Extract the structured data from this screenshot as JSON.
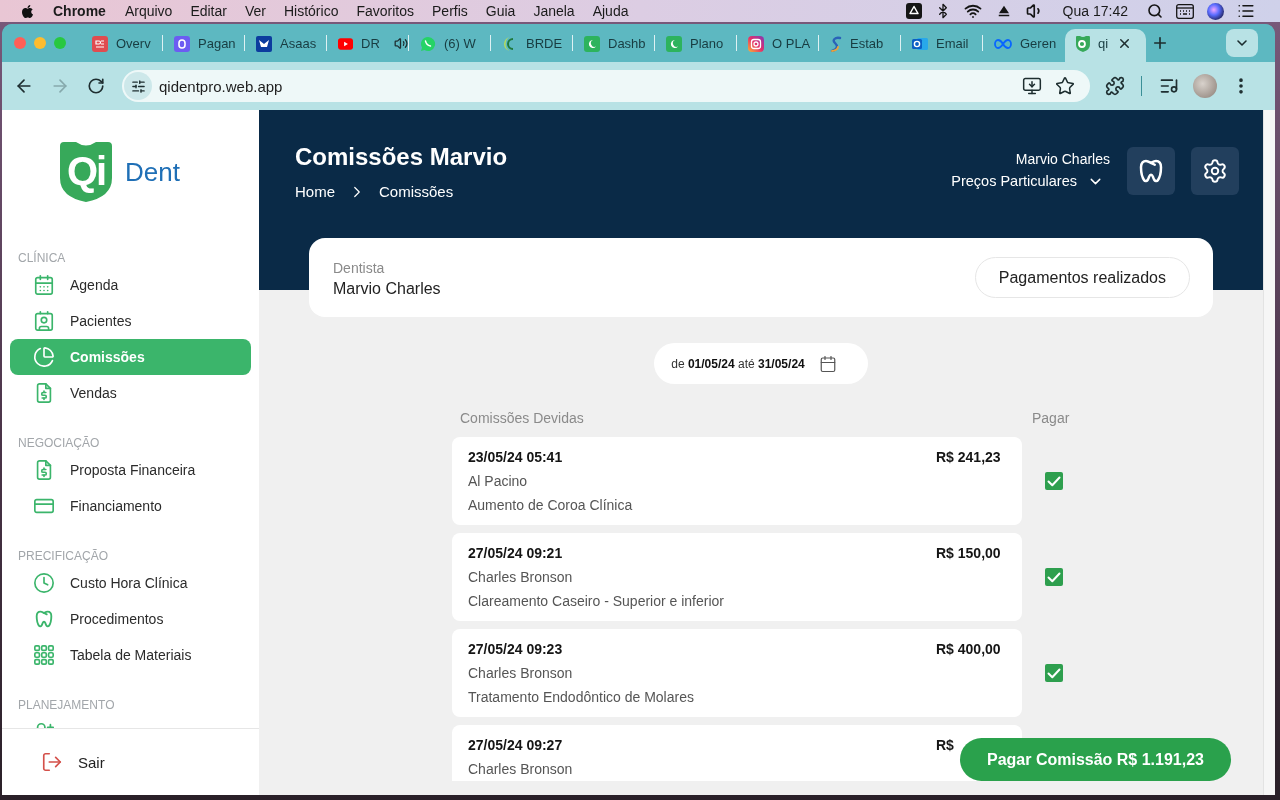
{
  "menu_bar": {
    "app": "Chrome",
    "menus": [
      "Arquivo",
      "Editar",
      "Ver",
      "Histórico",
      "Favoritos",
      "Perfis",
      "Guia",
      "Janela",
      "Ajuda"
    ],
    "clock": "Qua 17:42"
  },
  "browser": {
    "tabs": [
      {
        "title": "Overv",
        "selected": false,
        "audio": false
      },
      {
        "title": "Pagan",
        "selected": false,
        "audio": false
      },
      {
        "title": "Asaas",
        "selected": false,
        "audio": false
      },
      {
        "title": "DR",
        "selected": false,
        "audio": true
      },
      {
        "title": "(6) W",
        "selected": false,
        "audio": false
      },
      {
        "title": "BRDE",
        "selected": false,
        "audio": false
      },
      {
        "title": "Dashb",
        "selected": false,
        "audio": false
      },
      {
        "title": "Plano",
        "selected": false,
        "audio": false
      },
      {
        "title": "O PLA",
        "selected": false,
        "audio": false
      },
      {
        "title": "Estab",
        "selected": false,
        "audio": false
      },
      {
        "title": "Email",
        "selected": false,
        "audio": false
      },
      {
        "title": "Geren",
        "selected": false,
        "audio": false
      },
      {
        "title": "qi",
        "selected": true,
        "audio": false
      }
    ],
    "nav_buttons": [
      {
        "kind": "back",
        "disabled": false
      },
      {
        "kind": "forward",
        "disabled": true
      },
      {
        "kind": "reload",
        "disabled": false
      }
    ],
    "address": "qidentpro.web.app"
  },
  "sidebar": {
    "logo": {
      "mark": "Qi",
      "name": "Dent"
    },
    "sections": [
      {
        "title": "CLÍNICA",
        "items": [
          {
            "kind": "link",
            "label": "Agenda",
            "selected": false
          },
          {
            "kind": "link",
            "label": "Pacientes",
            "selected": false
          },
          {
            "kind": "link",
            "label": "Comissões",
            "selected": true
          },
          {
            "kind": "link",
            "label": "Vendas",
            "selected": false
          }
        ]
      },
      {
        "title": "NEGOCIAÇÃO",
        "items": [
          {
            "kind": "link",
            "label": "Proposta Financeira",
            "selected": false
          },
          {
            "kind": "link",
            "label": "Financiamento",
            "selected": false
          }
        ]
      },
      {
        "title": "PRECIFICAÇÃO",
        "items": [
          {
            "kind": "link",
            "label": "Custo Hora Clínica",
            "selected": false
          },
          {
            "kind": "link",
            "label": "Procedimentos",
            "selected": false
          },
          {
            "kind": "link",
            "label": "Tabela de Materiais",
            "selected": false
          }
        ]
      },
      {
        "title": "PLANEJAMENTO",
        "items": [
          {
            "kind": "icon-only",
            "selected": false
          }
        ]
      }
    ],
    "logout": "Sair"
  },
  "header": {
    "title": "Comissões Marvio",
    "breadcrumb": [
      "Home",
      "Comissões"
    ],
    "user": "Marvio Charles",
    "price_table": "Preços Particulares"
  },
  "dentist_card": {
    "label": "Dentista",
    "value": "Marvio Charles",
    "button": "Pagamentos realizados"
  },
  "date_range": "de **01/05/24** até **31/05/24**",
  "commissions": {
    "heading": "Comissões Devidas",
    "pay_heading": "Pagar",
    "rows": [
      {
        "datetime": "23/05/24 05:41",
        "amount": "R$ 241,23",
        "patient": "Al Pacino",
        "procedure": "Aumento de Coroa Clínica",
        "checked": true
      },
      {
        "datetime": "27/05/24 09:21",
        "amount": "R$ 150,00",
        "patient": "Charles Bronson",
        "procedure": "Clareamento Caseiro - Superior e inferior",
        "checked": true
      },
      {
        "datetime": "27/05/24 09:23",
        "amount": "R$ 400,00",
        "patient": "Charles Bronson",
        "procedure": "Tratamento Endodôntico de Molares",
        "checked": true
      },
      {
        "datetime": "27/05/24 09:27",
        "amount": "R$",
        "patient": "Charles Bronson"
      }
    ]
  },
  "pay_button": "Pagar Comissão R$ 1.191,23"
}
